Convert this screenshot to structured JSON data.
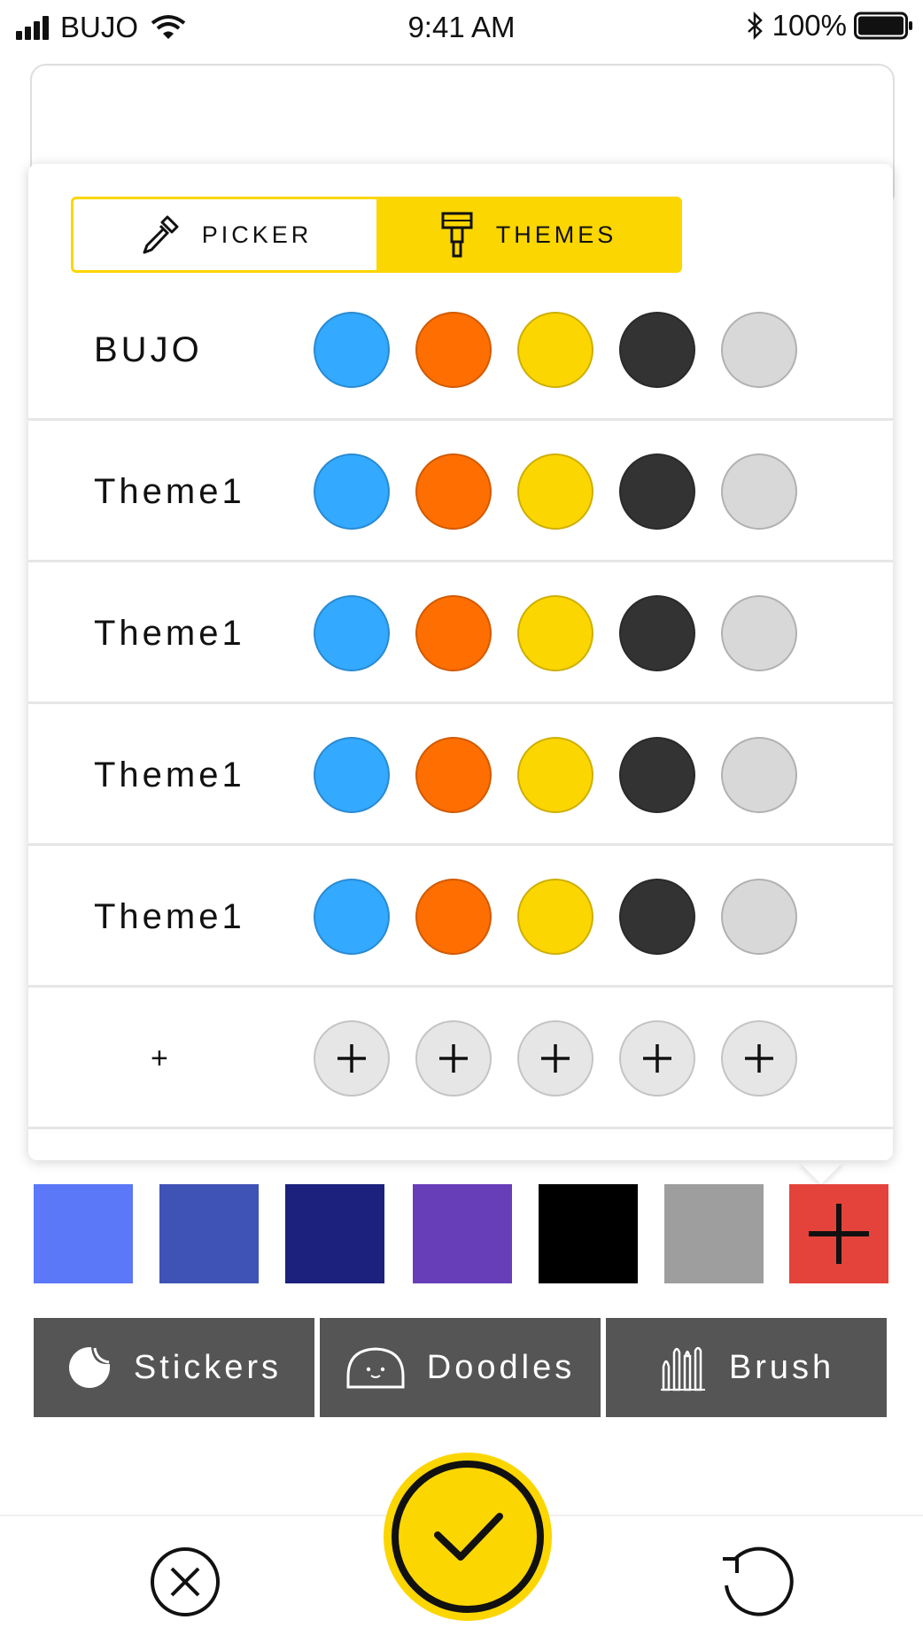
{
  "status_bar": {
    "carrier": "BUJO",
    "time": "9:41 AM",
    "battery": "100%",
    "icons": [
      "signal-icon",
      "wifi-icon",
      "bluetooth-icon",
      "battery-icon"
    ]
  },
  "segment": {
    "picker_label": "PICKER",
    "themes_label": "THEMES",
    "active": "THEMES"
  },
  "themes": [
    {
      "name": "BUJO",
      "colors": [
        "#33a9ff",
        "#ff6e00",
        "#fcd600",
        "#333333",
        "#d8d8d8"
      ]
    },
    {
      "name": "Theme1",
      "colors": [
        "#33a9ff",
        "#ff6e00",
        "#fcd600",
        "#333333",
        "#d8d8d8"
      ]
    },
    {
      "name": "Theme1",
      "colors": [
        "#33a9ff",
        "#ff6e00",
        "#fcd600",
        "#333333",
        "#d8d8d8"
      ]
    },
    {
      "name": "Theme1",
      "colors": [
        "#33a9ff",
        "#ff6e00",
        "#fcd600",
        "#333333",
        "#d8d8d8"
      ]
    },
    {
      "name": "Theme1",
      "colors": [
        "#33a9ff",
        "#ff6e00",
        "#fcd600",
        "#333333",
        "#d8d8d8"
      ]
    }
  ],
  "add_row": {
    "label": "+"
  },
  "color_palette": [
    "#5a78f8",
    "#3f52b5",
    "#1b217c",
    "#683db8",
    "#000000",
    "#9e9e9e"
  ],
  "add_color_color": "#e4433b",
  "tools": [
    {
      "label": "Stickers",
      "icon": "sticker-icon"
    },
    {
      "label": "Doodles",
      "icon": "doodle-face-icon"
    },
    {
      "label": "Brush",
      "icon": "brushes-icon"
    }
  ],
  "accent_color": "#fcd600",
  "bottom_bar": {
    "icons": [
      "close-circle-icon",
      "checkmark-icon",
      "undo-icon"
    ]
  }
}
